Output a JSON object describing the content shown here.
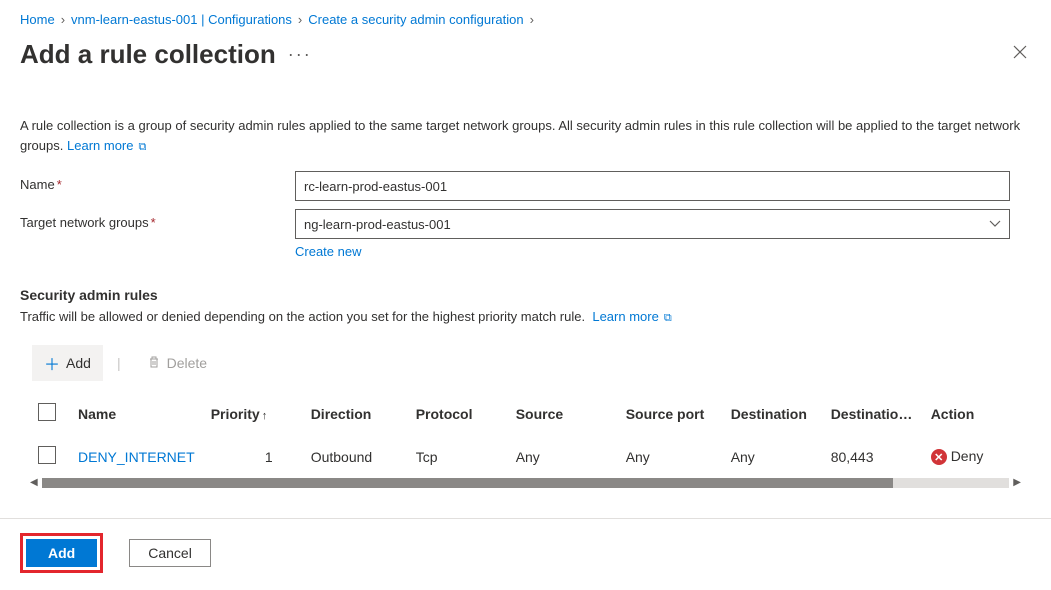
{
  "breadcrumb": {
    "items": [
      {
        "label": "Home"
      },
      {
        "label": "vnm-learn-eastus-001 | Configurations"
      },
      {
        "label": "Create a security admin configuration"
      }
    ]
  },
  "title": "Add a rule collection",
  "description": {
    "text": "A rule collection is a group of security admin rules applied to the same target network groups. All security admin rules in this rule collection will be applied to the target network groups.",
    "learn_more": "Learn more"
  },
  "form": {
    "name_label": "Name",
    "name_value": "rc-learn-prod-eastus-001",
    "tng_label": "Target network groups",
    "tng_value": "ng-learn-prod-eastus-001",
    "create_new": "Create new"
  },
  "rules_section": {
    "heading": "Security admin rules",
    "sub": "Traffic will be allowed or denied depending on the action you set for the highest priority match rule.",
    "learn_more": "Learn more"
  },
  "toolbar": {
    "add": "Add",
    "delete": "Delete"
  },
  "table": {
    "headers": {
      "name": "Name",
      "priority": "Priority",
      "direction": "Direction",
      "protocol": "Protocol",
      "source": "Source",
      "source_port": "Source port",
      "destination": "Destination",
      "destination_port": "Destinatio…",
      "action": "Action"
    },
    "rows": [
      {
        "name": "DENY_INTERNET",
        "priority": "1",
        "direction": "Outbound",
        "protocol": "Tcp",
        "source": "Any",
        "source_port": "Any",
        "destination": "Any",
        "destination_port": "80,443",
        "action": "Deny"
      }
    ]
  },
  "footer": {
    "add": "Add",
    "cancel": "Cancel"
  }
}
